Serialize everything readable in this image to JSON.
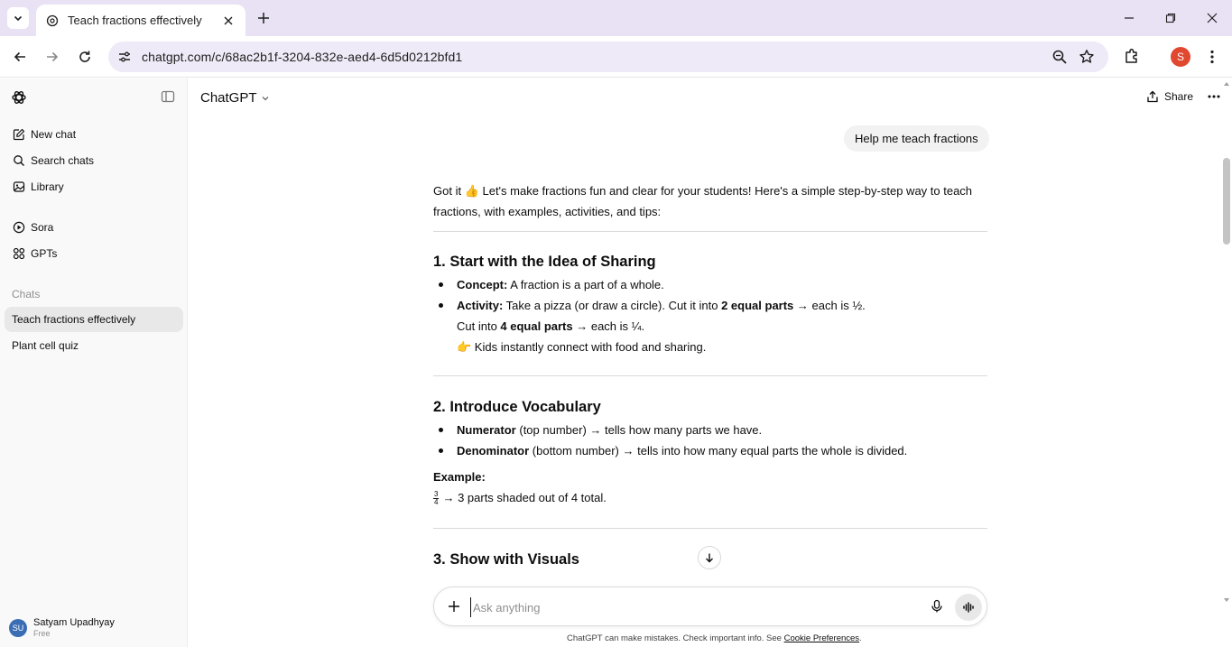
{
  "browser": {
    "tab_title": "Teach fractions effectively",
    "url": "chatgpt.com/c/68ac2b1f-3204-832e-aed4-6d5d0212bfd1",
    "profile_initial": "S",
    "accent_color": "#e9e2f5"
  },
  "sidebar": {
    "nav": [
      {
        "label": "New chat",
        "icon": "edit-icon"
      },
      {
        "label": "Search chats",
        "icon": "search-icon"
      },
      {
        "label": "Library",
        "icon": "library-icon"
      },
      {
        "label": "Sora",
        "icon": "play-circle-icon"
      },
      {
        "label": "GPTs",
        "icon": "grid-icon"
      }
    ],
    "section_label": "Chats",
    "chats": [
      {
        "label": "Teach fractions effectively",
        "active": true
      },
      {
        "label": "Plant cell quiz",
        "active": false
      }
    ],
    "user": {
      "initials": "SU",
      "name": "Satyam Upadhyay",
      "plan": "Free"
    }
  },
  "header": {
    "model": "ChatGPT",
    "share_label": "Share"
  },
  "conversation": {
    "user_message": "Help me teach fractions",
    "intro_1": "Got it ",
    "intro_emoji": "👍",
    "intro_2": " Let's make fractions fun and clear for your students! Here's a simple step-by-step way to teach fractions, with examples, activities, and tips:",
    "s1": {
      "heading": "1. Start with the Idea of Sharing",
      "b1_label": "Concept:",
      "b1_text": " A fraction is a part of a whole.",
      "b2_label": "Activity:",
      "b2_t1": " Take a pizza (or draw a circle). Cut it into ",
      "b2_bold1": "2 equal parts",
      "b2_t2": " → each is ½.",
      "b2_l2_t1": "Cut into ",
      "b2_l2_bold": "4 equal parts",
      "b2_l2_t2": " → each is ¼.",
      "b2_l3_emoji": "👉",
      "b2_l3_text": " Kids instantly connect with food and sharing."
    },
    "s2": {
      "heading": "2. Introduce Vocabulary",
      "b1_label": "Numerator",
      "b1_text": " (top number) → tells how many parts we have.",
      "b2_label": "Denominator",
      "b2_text": " (bottom number) → tells into how many equal parts the whole is divided.",
      "example_label": "Example:",
      "frac_num": "3",
      "frac_den": "4",
      "example_text": "→ 3 parts shaded out of 4 total."
    },
    "s3": {
      "heading": "3. Show with Visuals"
    }
  },
  "composer": {
    "placeholder": "Ask anything"
  },
  "footer": {
    "disclaimer": "ChatGPT can make mistakes. Check important info. See ",
    "link": "Cookie Preferences",
    "end": "."
  }
}
